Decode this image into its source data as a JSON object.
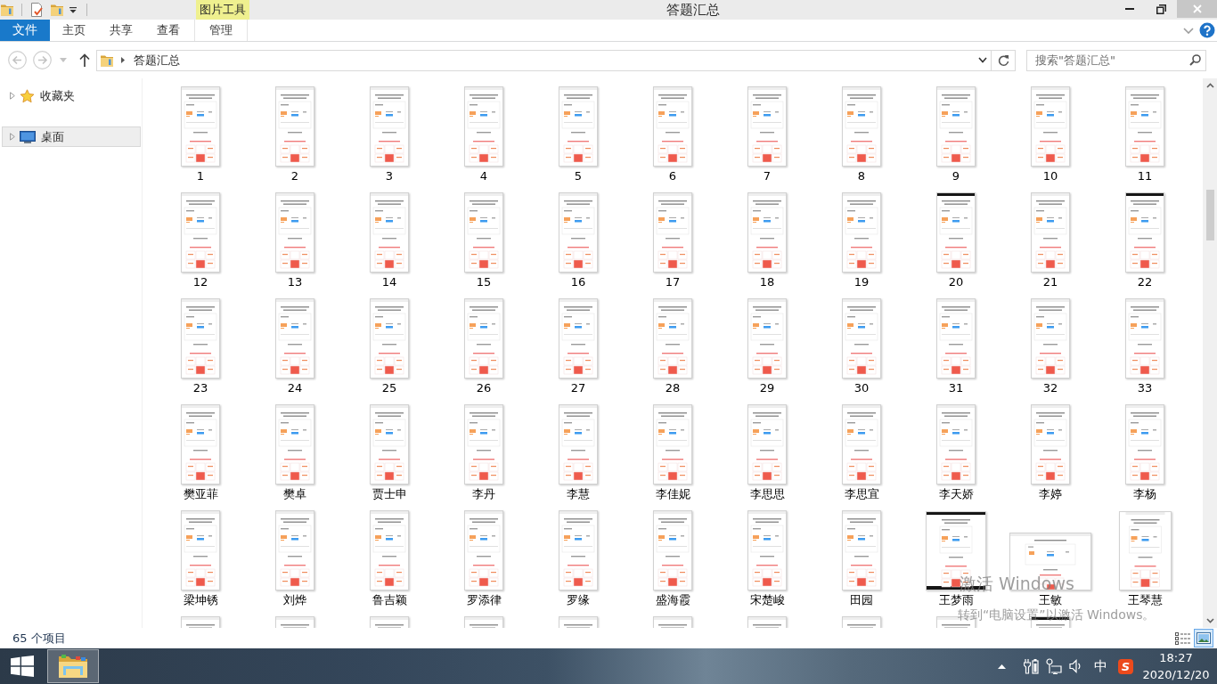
{
  "title_bar": {
    "title": "答题汇总",
    "context_group": "图片工具"
  },
  "ribbon": {
    "tabs": [
      {
        "label": "文件",
        "kind": "file"
      },
      {
        "label": "主页",
        "kind": "standard"
      },
      {
        "label": "共享",
        "kind": "standard"
      },
      {
        "label": "查看",
        "kind": "standard"
      },
      {
        "label": "管理",
        "kind": "context"
      }
    ]
  },
  "address_bar": {
    "path": [
      "答题汇总"
    ]
  },
  "search": {
    "placeholder": "搜索\"答题汇总\""
  },
  "navigation": {
    "items": [
      {
        "label": "收藏夹",
        "kind": "favorites",
        "expanded": false,
        "selected": false
      },
      {
        "label": "桌面",
        "kind": "desktop",
        "expanded": false,
        "selected": true
      }
    ]
  },
  "files": [
    {
      "name": "1",
      "kind": "phone"
    },
    {
      "name": "2",
      "kind": "phone"
    },
    {
      "name": "3",
      "kind": "phone"
    },
    {
      "name": "4",
      "kind": "phone"
    },
    {
      "name": "5",
      "kind": "phone"
    },
    {
      "name": "6",
      "kind": "phone"
    },
    {
      "name": "7",
      "kind": "phone"
    },
    {
      "name": "8",
      "kind": "phone"
    },
    {
      "name": "9",
      "kind": "phone"
    },
    {
      "name": "10",
      "kind": "phone"
    },
    {
      "name": "11",
      "kind": "phone"
    },
    {
      "name": "12",
      "kind": "phone"
    },
    {
      "name": "13",
      "kind": "phone"
    },
    {
      "name": "14",
      "kind": "phone"
    },
    {
      "name": "15",
      "kind": "phone"
    },
    {
      "name": "16",
      "kind": "phone"
    },
    {
      "name": "17",
      "kind": "phone"
    },
    {
      "name": "18",
      "kind": "phone"
    },
    {
      "name": "19",
      "kind": "phone"
    },
    {
      "name": "20",
      "kind": "phone-dark"
    },
    {
      "name": "21",
      "kind": "phone"
    },
    {
      "name": "22",
      "kind": "phone-dark"
    },
    {
      "name": "23",
      "kind": "phone"
    },
    {
      "name": "24",
      "kind": "phone"
    },
    {
      "name": "25",
      "kind": "phone"
    },
    {
      "name": "26",
      "kind": "phone"
    },
    {
      "name": "27",
      "kind": "phone"
    },
    {
      "name": "28",
      "kind": "phone"
    },
    {
      "name": "29",
      "kind": "phone"
    },
    {
      "name": "30",
      "kind": "phone"
    },
    {
      "name": "31",
      "kind": "phone"
    },
    {
      "name": "32",
      "kind": "phone"
    },
    {
      "name": "33",
      "kind": "phone"
    },
    {
      "name": "樊亚菲",
      "kind": "phone"
    },
    {
      "name": "樊卓",
      "kind": "phone"
    },
    {
      "name": "贾士申",
      "kind": "phone"
    },
    {
      "name": "李丹",
      "kind": "phone"
    },
    {
      "name": "李慧",
      "kind": "phone"
    },
    {
      "name": "李佳妮",
      "kind": "phone"
    },
    {
      "name": "李思思",
      "kind": "phone"
    },
    {
      "name": "李思宜",
      "kind": "phone"
    },
    {
      "name": "李天娇",
      "kind": "phone"
    },
    {
      "name": "李婷",
      "kind": "phone"
    },
    {
      "name": "李杨",
      "kind": "phone"
    },
    {
      "name": "梁坤锈",
      "kind": "phone"
    },
    {
      "name": "刘烨",
      "kind": "phone"
    },
    {
      "name": "鲁吉颖",
      "kind": "phone"
    },
    {
      "name": "罗添律",
      "kind": "phone"
    },
    {
      "name": "罗缘",
      "kind": "phone"
    },
    {
      "name": "盛海霞",
      "kind": "phone"
    },
    {
      "name": "宋楚峻",
      "kind": "phone"
    },
    {
      "name": "田园",
      "kind": "phone"
    },
    {
      "name": "王梦雨",
      "kind": "tablet-dark"
    },
    {
      "name": "王敏",
      "kind": "landscape"
    },
    {
      "name": "王琴慧",
      "kind": "tablet"
    }
  ],
  "files_cut_off": [
    {
      "kind": "phone"
    },
    {
      "kind": "phone"
    },
    {
      "kind": "phone"
    },
    {
      "kind": "phone"
    },
    {
      "kind": "phone"
    },
    {
      "kind": "phone"
    },
    {
      "kind": "phone"
    },
    {
      "kind": "phone"
    },
    {
      "kind": "phone"
    },
    {
      "kind": "phone-dark"
    }
  ],
  "status_bar": {
    "item_count": "65 个项目",
    "views": [
      {
        "kind": "details",
        "selected": false
      },
      {
        "kind": "thumbnails",
        "selected": true
      }
    ]
  },
  "taskbar": {
    "apps": [
      {
        "kind": "explorer",
        "selected": true
      }
    ],
    "tray": {
      "ime": "中",
      "ime_logo": "S",
      "time": "18:27",
      "date": "2020/12/20"
    }
  },
  "activation_notice": {
    "title": "激活 Windows",
    "message": "转到“电脑设置”以激活 Windows。"
  }
}
